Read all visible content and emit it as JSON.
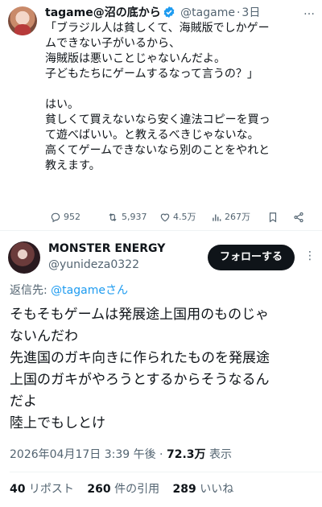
{
  "tweet": {
    "author_name": "tagame@沼の底から",
    "handle": "@tagame",
    "time": "3日",
    "more_glyph": "…",
    "body": "「ブラジル人は貧しくて、海賊版でしかゲー\nムできない子がいるから、\n海賊版は悪いことじゃないんだよ。\n子どもたちにゲームするなって言うの？」\n\nはい。\n貧しくて買えないなら安く違法コピーを買っ\nて遊べばいい。と教えるべきじゃないな。\n高くてゲームできないなら別のことをやれと\n教えます。",
    "replies": "952",
    "retweets": "5,937",
    "likes": "4.5万",
    "views": "267万",
    "icons": [
      "reply-icon",
      "retweet-icon",
      "like-icon",
      "views-icon",
      "bookmark-icon",
      "share-icon"
    ]
  },
  "reply": {
    "author_name": "MONSTER ENERGY",
    "handle": "@yunideza0322",
    "follow_label": "フォローする",
    "more_glyph": "⋮",
    "replying_prefix": "返信先: ",
    "replying_mention": "@tagameさん",
    "body": "そもそもゲームは発展途上国用のものじゃ\nないんだわ\n先進国のガキ向きに作られたものを発展途\n上国のガキがやろうとするからそうなるん\nだよ\n陸上でもしとけ",
    "timestamp": "2026年04月17日 3:39 午後",
    "separator": " · ",
    "views_count": "72.3万",
    "views_label": " 表示",
    "reposts_count": "40",
    "reposts_label": " リポスト",
    "quotes_count": "260",
    "quotes_label": " 件の引用",
    "likes_count": "289",
    "likes_label": " いいね"
  },
  "colors": {
    "accent": "#1d9bf0",
    "text": "#0f1419",
    "muted": "#536471",
    "divider": "#eff3f4"
  }
}
